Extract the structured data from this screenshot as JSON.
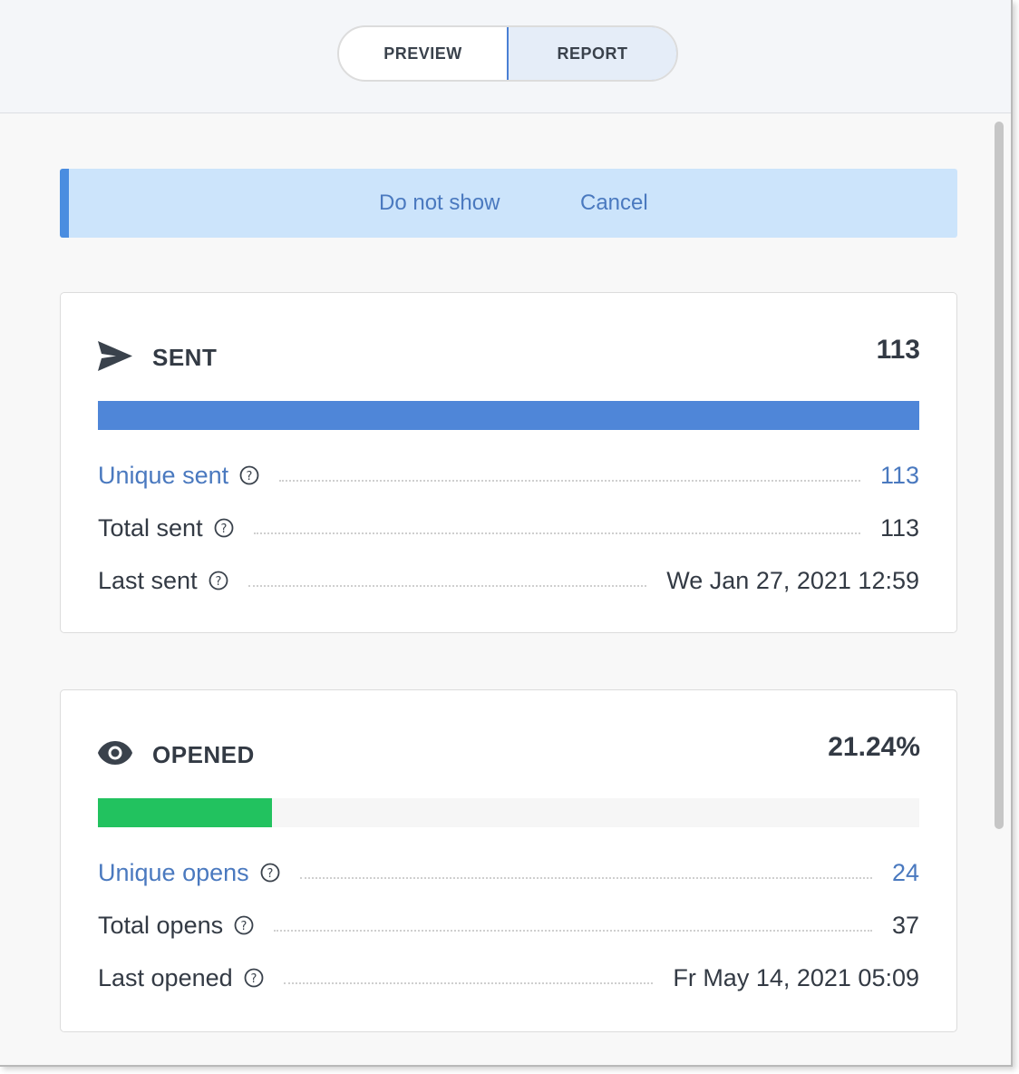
{
  "toggle": {
    "preview_label": "PREVIEW",
    "report_label": "REPORT",
    "active": "REPORT"
  },
  "banner": {
    "do_not_show_label": "Do not show",
    "cancel_label": "Cancel"
  },
  "colors": {
    "accent": "#4a79bf",
    "sent_bar": "#4f86d8",
    "opened_bar": "#22c25f",
    "banner_bg": "#cce4fb"
  },
  "sent": {
    "icon": "send-icon",
    "title": "SENT",
    "value": "113",
    "progress": 1.0,
    "rows": [
      {
        "label": "Unique sent",
        "value": "113",
        "link": true
      },
      {
        "label": "Total sent",
        "value": "113",
        "link": false
      },
      {
        "label": "Last sent",
        "value": "We Jan 27, 2021 12:59",
        "link": false
      }
    ]
  },
  "opened": {
    "icon": "eye-icon",
    "title": "OPENED",
    "value": "21.24%",
    "progress": 0.2124,
    "rows": [
      {
        "label": "Unique opens",
        "value": "24",
        "link": true
      },
      {
        "label": "Total opens",
        "value": "37",
        "link": false
      },
      {
        "label": "Last opened",
        "value": "Fr May 14, 2021 05:09",
        "link": false
      }
    ]
  }
}
